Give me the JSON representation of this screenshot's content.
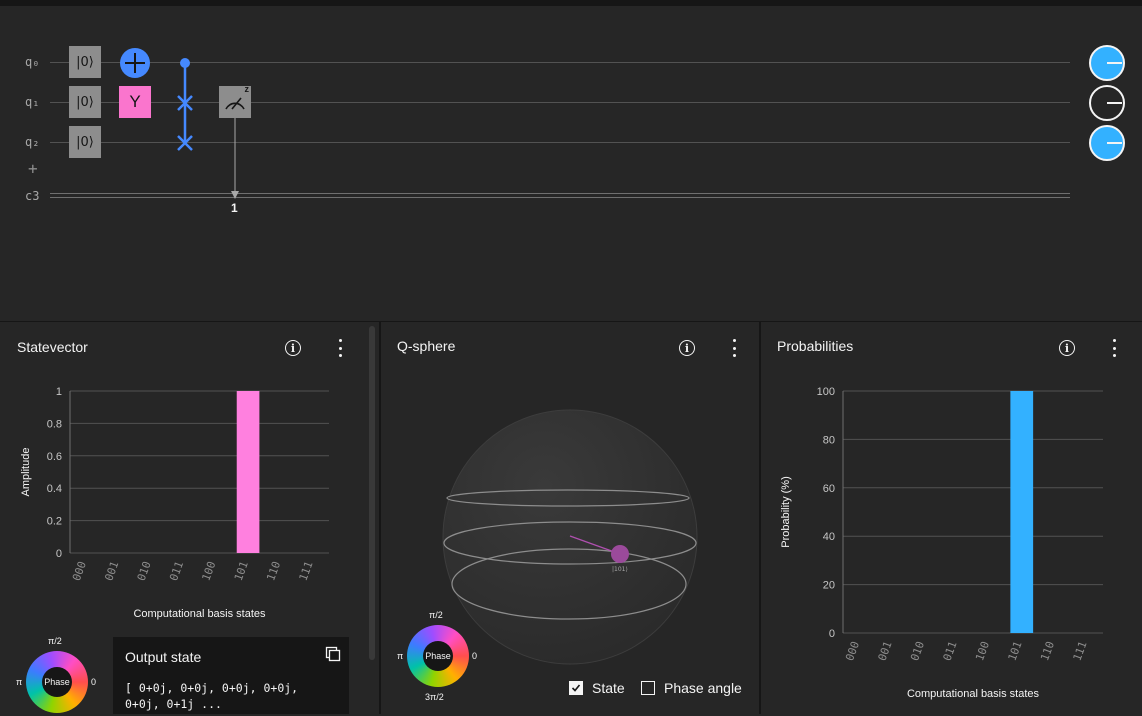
{
  "circuit": {
    "qubits": [
      "q₀",
      "q₁",
      "q₂"
    ],
    "add_label": "+",
    "classical": "c3",
    "init_label": "|0⟩",
    "y_label": "Y",
    "measure_target": "1",
    "meas_basis": "z",
    "colors": {
      "accent": "#4589ff",
      "y_gate": "#fa75cd",
      "gate_gray": "#8d8d8d"
    },
    "qubit_states": [
      1,
      0,
      1
    ]
  },
  "statevector": {
    "title": "Statevector",
    "ylabel": "Amplitude",
    "xlabel": "Computational basis states",
    "color": "#ff80df"
  },
  "qsphere": {
    "title": "Q-sphere",
    "state_label": "|101⟩",
    "state_checkbox": "State",
    "state_checked": true,
    "phase_checkbox": "Phase angle",
    "phase_checked": false
  },
  "probabilities": {
    "title": "Probabilities",
    "ylabel": "Probability (%)",
    "xlabel": "Computational basis states",
    "color": "#33b1ff"
  },
  "phase_wheel": {
    "center": "Phase",
    "top": "π/2",
    "left": "π",
    "right": "0",
    "bottom": "3π/2"
  },
  "output": {
    "title": "Output state",
    "line1": "[ 0+0j, 0+0j, 0+0j, 0+0j,",
    "line2": "0+0j, 0+1j ..."
  },
  "chart_data": [
    {
      "type": "bar",
      "title": "Statevector",
      "categories": [
        "000",
        "001",
        "010",
        "011",
        "100",
        "101",
        "110",
        "111"
      ],
      "values": [
        0,
        0,
        0,
        0,
        0,
        1,
        0,
        0
      ],
      "ylabel": "Amplitude",
      "xlabel": "Computational basis states",
      "ylim": [
        0,
        1
      ],
      "yticks": [
        0,
        0.2,
        0.4,
        0.6,
        0.8,
        1
      ],
      "grid": true
    },
    {
      "type": "bar",
      "title": "Probabilities",
      "categories": [
        "000",
        "001",
        "010",
        "011",
        "100",
        "101",
        "110",
        "111"
      ],
      "values": [
        0,
        0,
        0,
        0,
        0,
        100,
        0,
        0
      ],
      "ylabel": "Probability (%)",
      "xlabel": "Computational basis states",
      "ylim": [
        0,
        100
      ],
      "yticks": [
        0,
        20,
        40,
        60,
        80,
        100
      ],
      "grid": true
    }
  ]
}
